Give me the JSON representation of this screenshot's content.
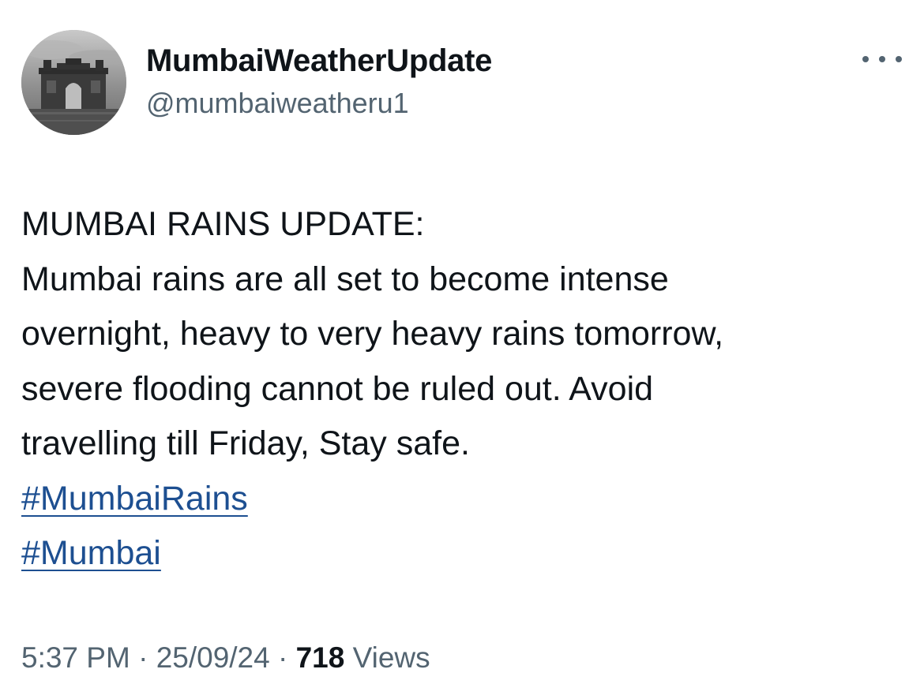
{
  "author": {
    "display_name": "MumbaiWeatherUpdate",
    "handle": "@mumbaiweatheru1",
    "avatar_icon": "gateway-of-india-avatar"
  },
  "menu": {
    "icon": "more-horizontal-icon"
  },
  "tweet": {
    "lines": [
      "MUMBAI RAINS UPDATE:",
      "Mumbai rains are all set to become intense",
      "overnight, heavy to very heavy rains tomorrow,",
      "severe flooding cannot be ruled out. Avoid",
      "travelling till Friday, Stay safe."
    ],
    "hashtags": [
      "#MumbaiRains",
      "#Mumbai"
    ]
  },
  "meta": {
    "time": "5:37 PM",
    "separator": " · ",
    "date": "25/09/24",
    "views_count": "718",
    "views_label": " Views"
  },
  "colors": {
    "text": "#0f1419",
    "secondary": "#536471",
    "link": "#1d4f91",
    "background": "#ffffff"
  }
}
